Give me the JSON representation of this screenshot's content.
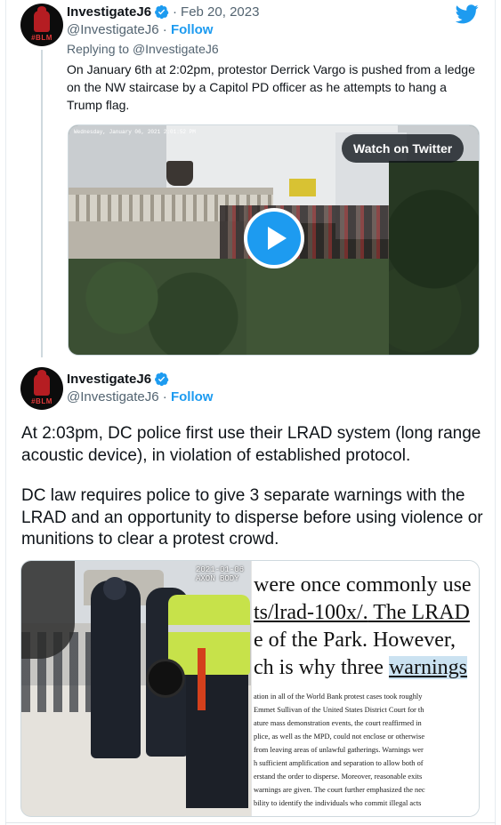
{
  "quoted_tweet": {
    "author_name": "InvestigateJ6",
    "date": "Feb 20, 2023",
    "handle": "@InvestigateJ6",
    "follow_label": "Follow",
    "avatar_text": "#BLM",
    "reply_prefix": "Replying to",
    "reply_handle": "@InvestigateJ6",
    "text": "On January 6th at 2:02pm, protestor Derrick Vargo is pushed from a ledge on the NW staircase by a Capitol PD officer as he attempts to hang a Trump flag.",
    "video": {
      "timestamp_overlay": "Wednesday, January 06, 2021 2:01:52 PM",
      "watch_label": "Watch on Twitter"
    }
  },
  "main_tweet": {
    "author_name": "InvestigateJ6",
    "handle": "@InvestigateJ6",
    "follow_label": "Follow",
    "avatar_text": "#BLM",
    "paragraph_1": "At 2:03pm, DC police first use their LRAD system (long range acoustic device), in violation of established protocol.",
    "paragraph_2": "DC law requires police to give 3 separate warnings with the LRAD and an opportunity to disperse before using violence or munitions to clear a protest crowd.",
    "image_left": {
      "stamp_line_1": "2021-01-06",
      "stamp_line_2": "AXON BODY"
    },
    "image_right": {
      "big_lines": [
        {
          "pre": "were once commonly use",
          "mark": "",
          "post": "",
          "style": "plain"
        },
        {
          "pre": "",
          "mark": "ts/lrad-100x/.",
          "post": " The LRAD",
          "style": "underline"
        },
        {
          "pre": "e of the Park. However, ",
          "mark": "",
          "post": "",
          "style": "plain"
        },
        {
          "pre": "ch is why three ",
          "mark": "warnings",
          "post": "",
          "style": "highlight"
        }
      ],
      "small_lines": [
        "ation in all of the World Bank protest cases took roughly",
        "Emmet Sullivan of the United States District Court for th",
        "ature mass demonstration events, the court reaffirmed in",
        "plice, as well as the MPD, could not enclose or otherwise",
        "from leaving areas of unlawful gatherings. Warnings wer",
        "h sufficient amplification and separation to allow both of",
        "erstand the order to disperse. Moreover, reasonable exits",
        "warnings are given. The court further emphasized the nec",
        "bility to identify the individuals who commit illegal acts"
      ]
    }
  },
  "colors": {
    "accent": "#1d9bf0",
    "text_primary": "#0f1419",
    "text_secondary": "#536471"
  },
  "icons": {
    "verified": "verified-badge-icon",
    "brand": "twitter-bird-icon",
    "play": "play-icon"
  }
}
